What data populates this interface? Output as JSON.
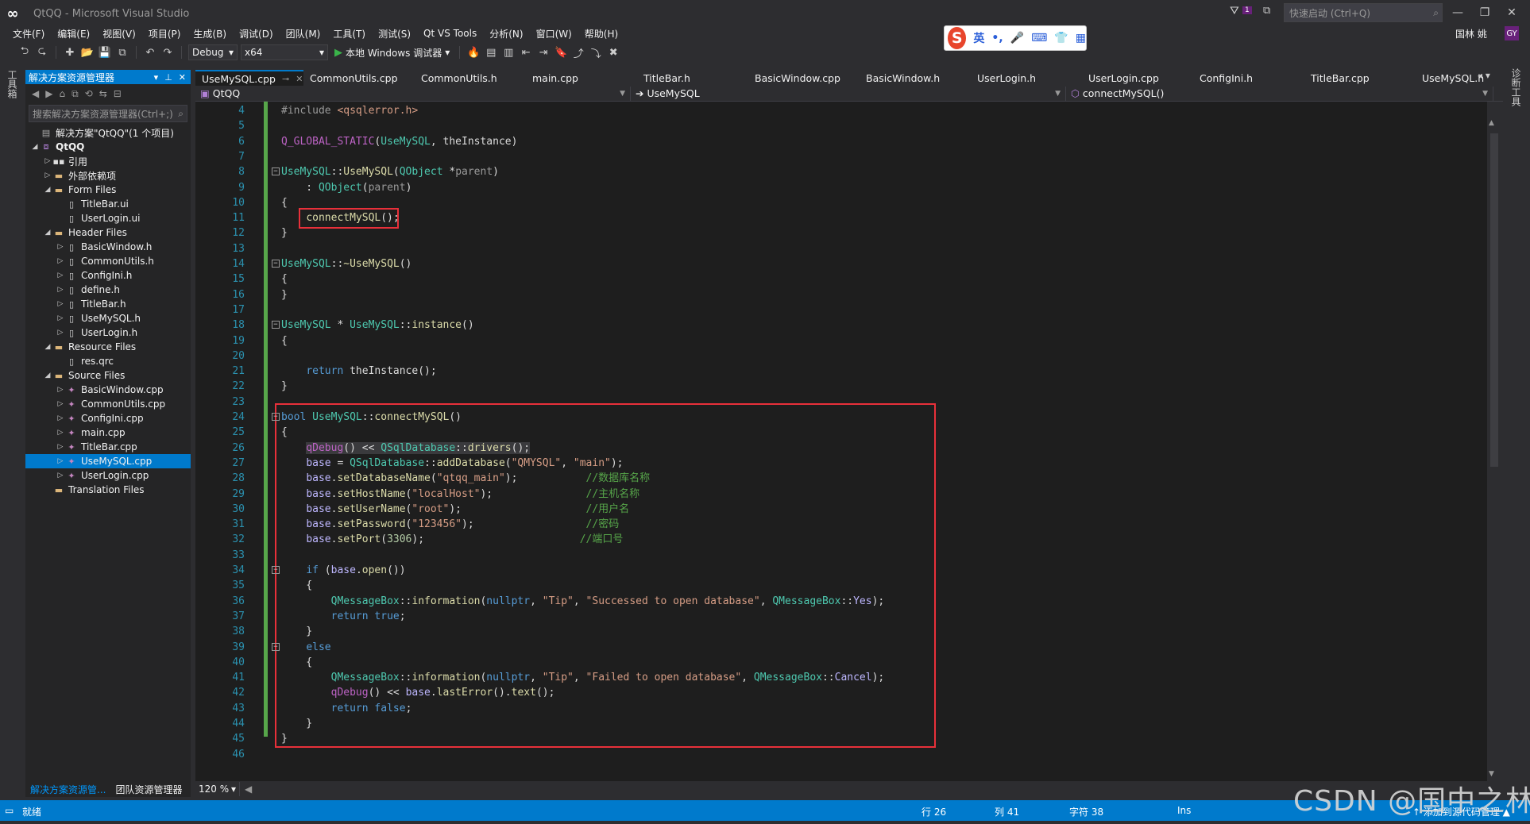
{
  "window": {
    "title": "QtQQ - Microsoft Visual Studio"
  },
  "title_bar": {
    "notification_count": "1",
    "quick_launch_placeholder": "快速启动 (Ctrl+Q)",
    "user_name": "国林 姚",
    "user_avatar": "GY"
  },
  "ime_bar": {
    "lang": "英",
    "items": [
      "•,",
      "🎤",
      "⌨",
      "👕",
      "▦"
    ]
  },
  "menu": [
    "文件(F)",
    "编辑(E)",
    "视图(V)",
    "项目(P)",
    "生成(B)",
    "调试(D)",
    "团队(M)",
    "工具(T)",
    "测试(S)",
    "Qt VS Tools",
    "分析(N)",
    "窗口(W)",
    "帮助(H)"
  ],
  "toolbar": {
    "configuration": "Debug",
    "platform": "x64",
    "run_label": "本地 Windows 调试器"
  },
  "left_strip": {
    "toolbox_label": "工具箱"
  },
  "right_strip": {
    "label": "诊断工具"
  },
  "solution_explorer": {
    "title": "解决方案资源管理器",
    "search_placeholder": "搜索解决方案资源管理器(Ctrl+;)",
    "tree": [
      {
        "label": "解决方案\"QtQQ\"(1 个项目)",
        "level": 0,
        "arrow": "",
        "icon": "sln"
      },
      {
        "label": "QtQQ",
        "level": 0,
        "arrow": "down",
        "icon": "proj",
        "bold": true
      },
      {
        "label": "引用",
        "level": 1,
        "arrow": "right",
        "icon": "ref"
      },
      {
        "label": "外部依赖项",
        "level": 1,
        "arrow": "right",
        "icon": "folder"
      },
      {
        "label": "Form Files",
        "level": 1,
        "arrow": "down",
        "icon": "folder"
      },
      {
        "label": "TitleBar.ui",
        "level": 2,
        "arrow": "",
        "icon": "file"
      },
      {
        "label": "UserLogin.ui",
        "level": 2,
        "arrow": "",
        "icon": "file"
      },
      {
        "label": "Header Files",
        "level": 1,
        "arrow": "down",
        "icon": "folder"
      },
      {
        "label": "BasicWindow.h",
        "level": 2,
        "arrow": "right",
        "icon": "file"
      },
      {
        "label": "CommonUtils.h",
        "level": 2,
        "arrow": "right",
        "icon": "file"
      },
      {
        "label": "ConfigIni.h",
        "level": 2,
        "arrow": "right",
        "icon": "file"
      },
      {
        "label": "define.h",
        "level": 2,
        "arrow": "right",
        "icon": "file"
      },
      {
        "label": "TitleBar.h",
        "level": 2,
        "arrow": "right",
        "icon": "file"
      },
      {
        "label": "UseMySQL.h",
        "level": 2,
        "arrow": "right",
        "icon": "file"
      },
      {
        "label": "UserLogin.h",
        "level": 2,
        "arrow": "right",
        "icon": "file"
      },
      {
        "label": "Resource Files",
        "level": 1,
        "arrow": "down",
        "icon": "folder"
      },
      {
        "label": "res.qrc",
        "level": 2,
        "arrow": "",
        "icon": "file"
      },
      {
        "label": "Source Files",
        "level": 1,
        "arrow": "down",
        "icon": "folder"
      },
      {
        "label": "BasicWindow.cpp",
        "level": 2,
        "arrow": "right",
        "icon": "cpp"
      },
      {
        "label": "CommonUtils.cpp",
        "level": 2,
        "arrow": "right",
        "icon": "cpp"
      },
      {
        "label": "ConfigIni.cpp",
        "level": 2,
        "arrow": "right",
        "icon": "cpp"
      },
      {
        "label": "main.cpp",
        "level": 2,
        "arrow": "right",
        "icon": "cpp"
      },
      {
        "label": "TitleBar.cpp",
        "level": 2,
        "arrow": "right",
        "icon": "cpp"
      },
      {
        "label": "UseMySQL.cpp",
        "level": 2,
        "arrow": "right",
        "icon": "cpp",
        "selected": true
      },
      {
        "label": "UserLogin.cpp",
        "level": 2,
        "arrow": "right",
        "icon": "cpp"
      },
      {
        "label": "Translation Files",
        "level": 1,
        "arrow": "",
        "icon": "folder"
      }
    ],
    "bottom_tabs": [
      "解决方案资源管...",
      "团队资源管理器"
    ]
  },
  "doc_tabs": [
    {
      "label": "UseMySQL.cpp",
      "active": true
    },
    {
      "label": "CommonUtils.cpp"
    },
    {
      "label": "CommonUtils.h"
    },
    {
      "label": "main.cpp"
    },
    {
      "label": "TitleBar.h"
    },
    {
      "label": "BasicWindow.cpp"
    },
    {
      "label": "BasicWindow.h"
    },
    {
      "label": "UserLogin.h"
    },
    {
      "label": "UserLogin.cpp"
    },
    {
      "label": "ConfigIni.h"
    },
    {
      "label": "TitleBar.cpp"
    },
    {
      "label": "UseMySQL.h"
    }
  ],
  "nav_bar": {
    "project": "QtQQ",
    "scope": "UseMySQL",
    "member": "connectMySQL()"
  },
  "editor": {
    "zoom": "120 %",
    "lines": [
      {
        "n": "4",
        "html": "<span class='pp'>#include</span> <span class='h'>&lt;qsqlerror.h&gt;</span>"
      },
      {
        "n": "5",
        "html": ""
      },
      {
        "n": "6",
        "html": "<span class='mac'>Q_GLOBAL_STATIC</span>(<span class='t'>UseMySQL</span>, theInstance)"
      },
      {
        "n": "7",
        "html": ""
      },
      {
        "n": "8",
        "html": "<span class='t'>UseMySQL</span>::<span class='f'>UseMySQL</span>(<span class='t'>QObject</span> *<span class='prm'>parent</span>)"
      },
      {
        "n": "9",
        "html": "    : <span class='t'>QObject</span>(<span class='prm'>parent</span>)"
      },
      {
        "n": "10",
        "html": "{"
      },
      {
        "n": "11",
        "html": "    <span class='f'>connectMySQL</span>();"
      },
      {
        "n": "12",
        "html": "}"
      },
      {
        "n": "13",
        "html": ""
      },
      {
        "n": "14",
        "html": "<span class='t'>UseMySQL</span>::<span class='f'>~UseMySQL</span>()"
      },
      {
        "n": "15",
        "html": "{"
      },
      {
        "n": "16",
        "html": "}"
      },
      {
        "n": "17",
        "html": ""
      },
      {
        "n": "18",
        "html": "<span class='t'>UseMySQL</span> * <span class='t'>UseMySQL</span>::<span class='f'>instance</span>()"
      },
      {
        "n": "19",
        "html": "{"
      },
      {
        "n": "20",
        "html": ""
      },
      {
        "n": "21",
        "html": "    <span class='k'>return</span> theInstance();"
      },
      {
        "n": "22",
        "html": "}"
      },
      {
        "n": "23",
        "html": ""
      },
      {
        "n": "24",
        "html": "<span class='k'>bool</span> <span class='t'>UseMySQL</span>::<span class='f'>connectMySQL</span>()"
      },
      {
        "n": "25",
        "html": "{"
      },
      {
        "n": "26",
        "html": "    <span class='hl'><span class='mac'>qDebug</span>() &lt;&lt; <span class='t'>QSqlDatabase</span>::<span class='f'>drivers</span>();</span>"
      },
      {
        "n": "27",
        "html": "    <span class='m'>base</span> = <span class='t'>QSqlDatabase</span>::<span class='f'>addDatabase</span>(<span class='s'>\"QMYSQL\"</span>, <span class='s'>\"main\"</span>);"
      },
      {
        "n": "28",
        "html": "    <span class='m'>base</span>.<span class='f'>setDatabaseName</span>(<span class='s'>\"qtqq_main\"</span>);           <span class='c'>//数据库名称</span>"
      },
      {
        "n": "29",
        "html": "    <span class='m'>base</span>.<span class='f'>setHostName</span>(<span class='s'>\"localHost\"</span>);               <span class='c'>//主机名称</span>"
      },
      {
        "n": "30",
        "html": "    <span class='m'>base</span>.<span class='f'>setUserName</span>(<span class='s'>\"root\"</span>);                    <span class='c'>//用户名</span>"
      },
      {
        "n": "31",
        "html": "    <span class='m'>base</span>.<span class='f'>setPassword</span>(<span class='s'>\"123456\"</span>);                  <span class='c'>//密码</span>"
      },
      {
        "n": "32",
        "html": "    <span class='m'>base</span>.<span class='f'>setPort</span>(<span class='num'>3306</span>);                         <span class='c'>//端口号</span>"
      },
      {
        "n": "33",
        "html": ""
      },
      {
        "n": "34",
        "html": "    <span class='k'>if</span> (<span class='m'>base</span>.<span class='f'>open</span>())"
      },
      {
        "n": "35",
        "html": "    {"
      },
      {
        "n": "36",
        "html": "        <span class='t'>QMessageBox</span>::<span class='f'>information</span>(<span class='k'>nullptr</span>, <span class='s'>\"Tip\"</span>, <span class='s'>\"Successed to open database\"</span>, <span class='t'>QMessageBox</span>::<span class='m'>Yes</span>);"
      },
      {
        "n": "37",
        "html": "        <span class='k'>return</span> <span class='k'>true</span>;"
      },
      {
        "n": "38",
        "html": "    }"
      },
      {
        "n": "39",
        "html": "    <span class='k'>else</span>"
      },
      {
        "n": "40",
        "html": "    {"
      },
      {
        "n": "41",
        "html": "        <span class='t'>QMessageBox</span>::<span class='f'>information</span>(<span class='k'>nullptr</span>, <span class='s'>\"Tip\"</span>, <span class='s'>\"Failed to open database\"</span>, <span class='t'>QMessageBox</span>::<span class='m'>Cancel</span>);"
      },
      {
        "n": "42",
        "html": "        <span class='mac'>qDebug</span>() &lt;&lt; <span class='m'>base</span>.<span class='f'>lastError</span>().<span class='f'>text</span>();"
      },
      {
        "n": "43",
        "html": "        <span class='k'>return</span> <span class='k'>false</span>;"
      },
      {
        "n": "44",
        "html": "    }"
      },
      {
        "n": "45",
        "html": "}"
      },
      {
        "n": "46",
        "html": ""
      }
    ]
  },
  "status_bar": {
    "ready": "就绪",
    "line": "行 26",
    "col": "列 41",
    "char": "字符 38",
    "mode": "Ins",
    "source_control": "↑ 添加到源代码管理 ▲"
  },
  "watermark": "CSDN @国中之林"
}
